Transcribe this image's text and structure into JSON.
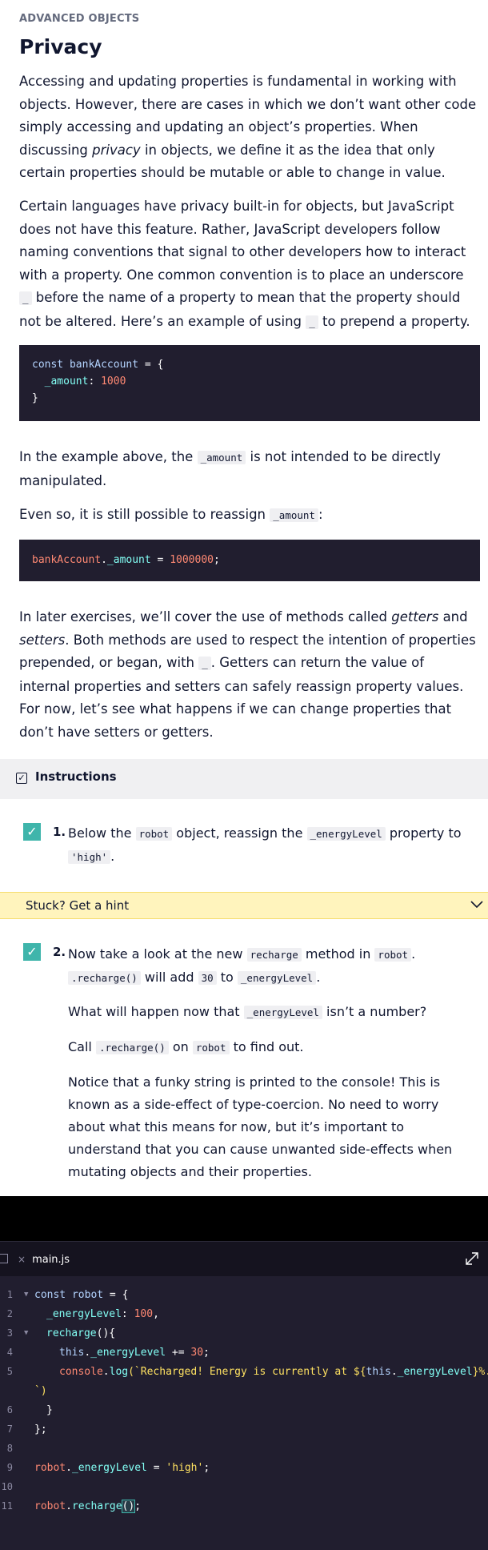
{
  "header": {
    "eyebrow": "ADVANCED OBJECTS",
    "title": "Privacy"
  },
  "intro": {
    "p1_a": "Accessing and updating properties is fundamental in working with objects. However, there are cases in which we don’t want other code simply accessing and updating an object’s properties. When discussing ",
    "p1_em": "privacy",
    "p1_b": " in objects, we define it as the idea that only certain properties should be mutable or able to change in value.",
    "p2_a": "Certain languages have privacy built-in for objects, but JavaScript does not have this feature. Rather, JavaScript developers follow naming conventions that signal to other developers how to interact with a property. One common convention is to place an underscore ",
    "p2_code1": "_",
    "p2_b": " before the name of a property to mean that the property should not be altered. Here’s an example of using ",
    "p2_code2": "_",
    "p2_c": " to prepend a property."
  },
  "code1": {
    "l1_kw": "const",
    "l1_name": "bankAccount",
    "l1_rest": " = {",
    "l2_prop": "_amount",
    "l2_colon": ": ",
    "l2_num": "1000",
    "l3": "}"
  },
  "mid": {
    "p3_a": "In the example above, the ",
    "p3_code": "_amount",
    "p3_b": " is not intended to be directly manipulated.",
    "p4_a": "Even so, it is still possible to reassign ",
    "p4_code": "_amount",
    "p4_b": ":"
  },
  "code2": {
    "obj": "bankAccount",
    "dot": ".",
    "prop": "_amount",
    "eq": " = ",
    "num": "1000000",
    "semi": ";"
  },
  "later": {
    "a": "In later exercises, we’ll cover the use of methods called ",
    "em1": "getters",
    "b": " and ",
    "em2": "setters",
    "c": ". Both methods are used to respect the intention of properties prepended, or began, with ",
    "code": "_",
    "d": ". Getters can return the value of internal properties and setters can safely reassign property values. For now, let’s see what happens if we can change properties that don’t have setters or getters."
  },
  "instructions": {
    "label": "Instructions"
  },
  "task1": {
    "check": "✓",
    "num": "1.",
    "a": "Below the ",
    "c1": "robot",
    "b": " object, reassign the ",
    "c2": "_energyLevel",
    "c": " property to ",
    "c3": "'high'",
    "d": "."
  },
  "hint": {
    "label": "Stuck? Get a hint"
  },
  "task2": {
    "check": "✓",
    "num": "2.",
    "a": "Now take a look at the new ",
    "c1": "recharge",
    "b": " method in ",
    "c2": "robot",
    "c": ".",
    "c3": ".recharge()",
    "d": " will add ",
    "c4": "30",
    "e": " to ",
    "c5": "_energyLevel",
    "f": ".",
    "p2_a": "What will happen now that ",
    "p2_code": "_energyLevel",
    "p2_b": " isn’t a number?",
    "p3_a": "Call ",
    "p3_code1": ".recharge()",
    "p3_b": " on ",
    "p3_code2": "robot",
    "p3_c": " to find out.",
    "p4": "Notice that a funky string is printed to the console! This is known as a side-effect of type-coercion. No need to worry about what this means for now, but it’s important to understand that you can cause unwanted side-effects when mutating objects and their properties."
  },
  "editor": {
    "tab_close": "×",
    "tab_name": "main.js",
    "line_numbers": [
      "1",
      "2",
      "3",
      "4",
      "5",
      "6",
      "7",
      "8",
      "9",
      "10",
      "11"
    ],
    "l1_kw": "const",
    "l1_name": " robot",
    "l1_rest": " = {",
    "l2_prop": "_energyLevel",
    "l2_colon": ": ",
    "l2_num": "100",
    "l2_comma": ",",
    "l3_name": "recharge",
    "l3_rest": "(){",
    "l4_this": "this",
    "l4_dot": ".",
    "l4_prop": "_energyLevel",
    "l4_op": " += ",
    "l4_num": "30",
    "l4_semi": ";",
    "l5_obj": "console",
    "l5_dot": ".",
    "l5_fn": "log",
    "l5_open": "(`Recharged! Energy is currently at ${",
    "l5_this": "this",
    "l5_dot2": ".",
    "l5_prop": "_energyLevel",
    "l5_close": "}%.",
    "l5_wrap": "`)",
    "l6": "}",
    "l7": "};",
    "l9_obj": "robot",
    "l9_dot": ".",
    "l9_prop": "_energyLevel",
    "l9_eq": " = ",
    "l9_str": "'high'",
    "l9_semi": ";",
    "l11_obj": "robot",
    "l11_dot": ".",
    "l11_fn": "recharge",
    "l11_parens": "()",
    "l11_semi": ";"
  }
}
